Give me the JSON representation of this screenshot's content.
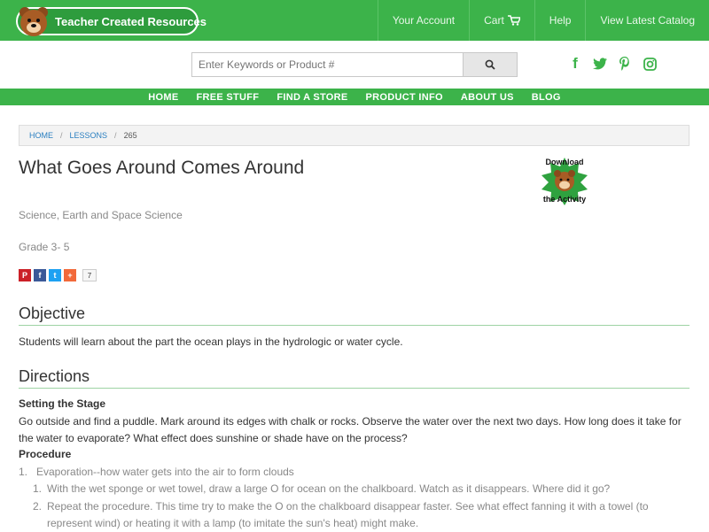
{
  "header": {
    "logo_text": "Teacher Created Resources",
    "nav": [
      "Your Account",
      "Cart",
      "Help",
      "View Latest Catalog"
    ]
  },
  "search": {
    "placeholder": "Enter Keywords or Product #"
  },
  "social": [
    "facebook-icon",
    "twitter-icon",
    "pinterest-icon",
    "instagram-icon"
  ],
  "main_nav": [
    "HOME",
    "FREE STUFF",
    "FIND A STORE",
    "PRODUCT INFO",
    "ABOUT US",
    "BLOG"
  ],
  "breadcrumb": [
    "HOME",
    "LESSONS",
    "265"
  ],
  "lesson": {
    "title": "What Goes Around Comes Around",
    "download_top": "Download",
    "download_bottom": "the Activity",
    "subject": "Science, Earth and Space Science",
    "grade": "Grade 3- 5",
    "share_count": "7"
  },
  "objective": {
    "heading": "Objective",
    "text": "Students will learn about the part the ocean plays in the hydrologic or water cycle."
  },
  "directions": {
    "heading": "Directions",
    "stage_heading": "Setting the Stage",
    "stage_line1": "Go outside and find a puddle. Mark around its edges with chalk or rocks. Observe the water over the next two days. How long does it take for",
    "stage_line2": "the water to evaporate? What effect does sunshine or shade have on the process?",
    "procedure_heading": "Procedure",
    "item1_num": "1.",
    "item1": "Evaporation--how water gets into the air to form clouds",
    "sub1_num": "1.",
    "sub1": "With the wet sponge or wet towel, draw a large O for ocean on the chalkboard. Watch as it disappears. Where did it go?",
    "sub2_num": "2.",
    "sub2_line1": "Repeat the procedure. This time try to make the O on the chalkboard disappear faster. See what effect fanning it with a towel (to",
    "sub2_line2": "represent wind) or heating it with a lamp (to imitate the sun's heat) might make."
  },
  "colors": {
    "brand_green": "#3cb34a",
    "link_blue": "#2a7fc0"
  }
}
